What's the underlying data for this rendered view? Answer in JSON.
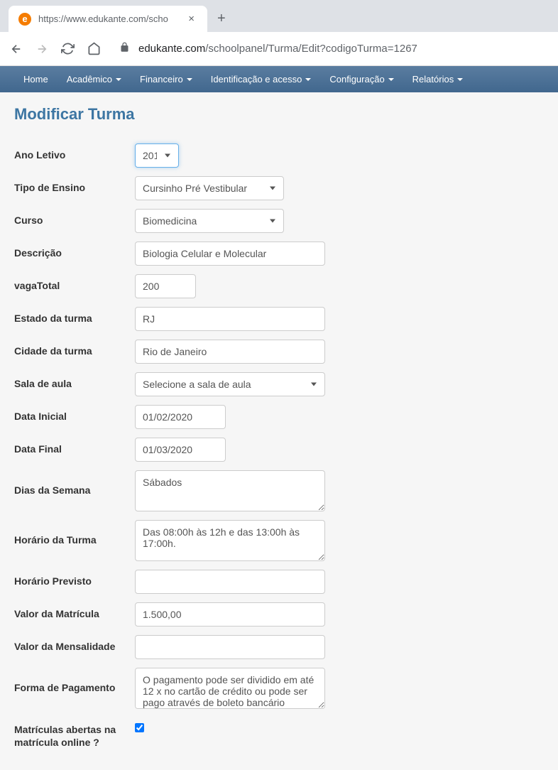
{
  "browser": {
    "tab_title": "https://www.edukante.com/scho",
    "url_domain": "edukante.com",
    "url_path": "/schoolpanel/Turma/Edit?codigoTurma=1267"
  },
  "navbar": {
    "items": [
      {
        "label": "Home",
        "dropdown": false
      },
      {
        "label": "Acadêmico",
        "dropdown": true
      },
      {
        "label": "Financeiro",
        "dropdown": true
      },
      {
        "label": "Identificação e acesso",
        "dropdown": true
      },
      {
        "label": "Configuração",
        "dropdown": true
      },
      {
        "label": "Relatórios",
        "dropdown": true
      }
    ]
  },
  "page": {
    "title": "Modificar Turma"
  },
  "form": {
    "ano_letivo": {
      "label": "Ano Letivo",
      "value": "201"
    },
    "tipo_ensino": {
      "label": "Tipo de Ensino",
      "value": "Cursinho Pré Vestibular"
    },
    "curso": {
      "label": "Curso",
      "value": "Biomedicina"
    },
    "descricao": {
      "label": "Descrição",
      "value": "Biologia Celular e Molecular"
    },
    "vaga_total": {
      "label": "vagaTotal",
      "value": "200"
    },
    "estado": {
      "label": "Estado da turma",
      "value": "RJ"
    },
    "cidade": {
      "label": "Cidade da turma",
      "value": "Rio de Janeiro"
    },
    "sala": {
      "label": "Sala de aula",
      "value": "Selecione a sala de aula"
    },
    "data_inicial": {
      "label": "Data Inicial",
      "value": "01/02/2020"
    },
    "data_final": {
      "label": "Data Final",
      "value": "01/03/2020"
    },
    "dias_semana": {
      "label": "Dias da Semana",
      "value": "Sábados"
    },
    "horario_turma": {
      "label": "Horário da Turma",
      "value": "Das 08:00h às 12h e das 13:00h às 17:00h."
    },
    "horario_previsto": {
      "label": "Horário Previsto",
      "value": ""
    },
    "valor_matricula": {
      "label": "Valor da Matrícula",
      "value": "1.500,00"
    },
    "valor_mensalidade": {
      "label": "Valor da Mensalidade",
      "value": ""
    },
    "forma_pagamento": {
      "label": "Forma de Pagamento",
      "value": "O pagamento pode ser dividido em até 12 x no cartão de crédito ou pode ser pago através de boleto bancário emitido ao final da matrícula online"
    },
    "matriculas_abertas": {
      "label": "Matrículas abertas na matrícula online ?",
      "checked": true
    }
  }
}
